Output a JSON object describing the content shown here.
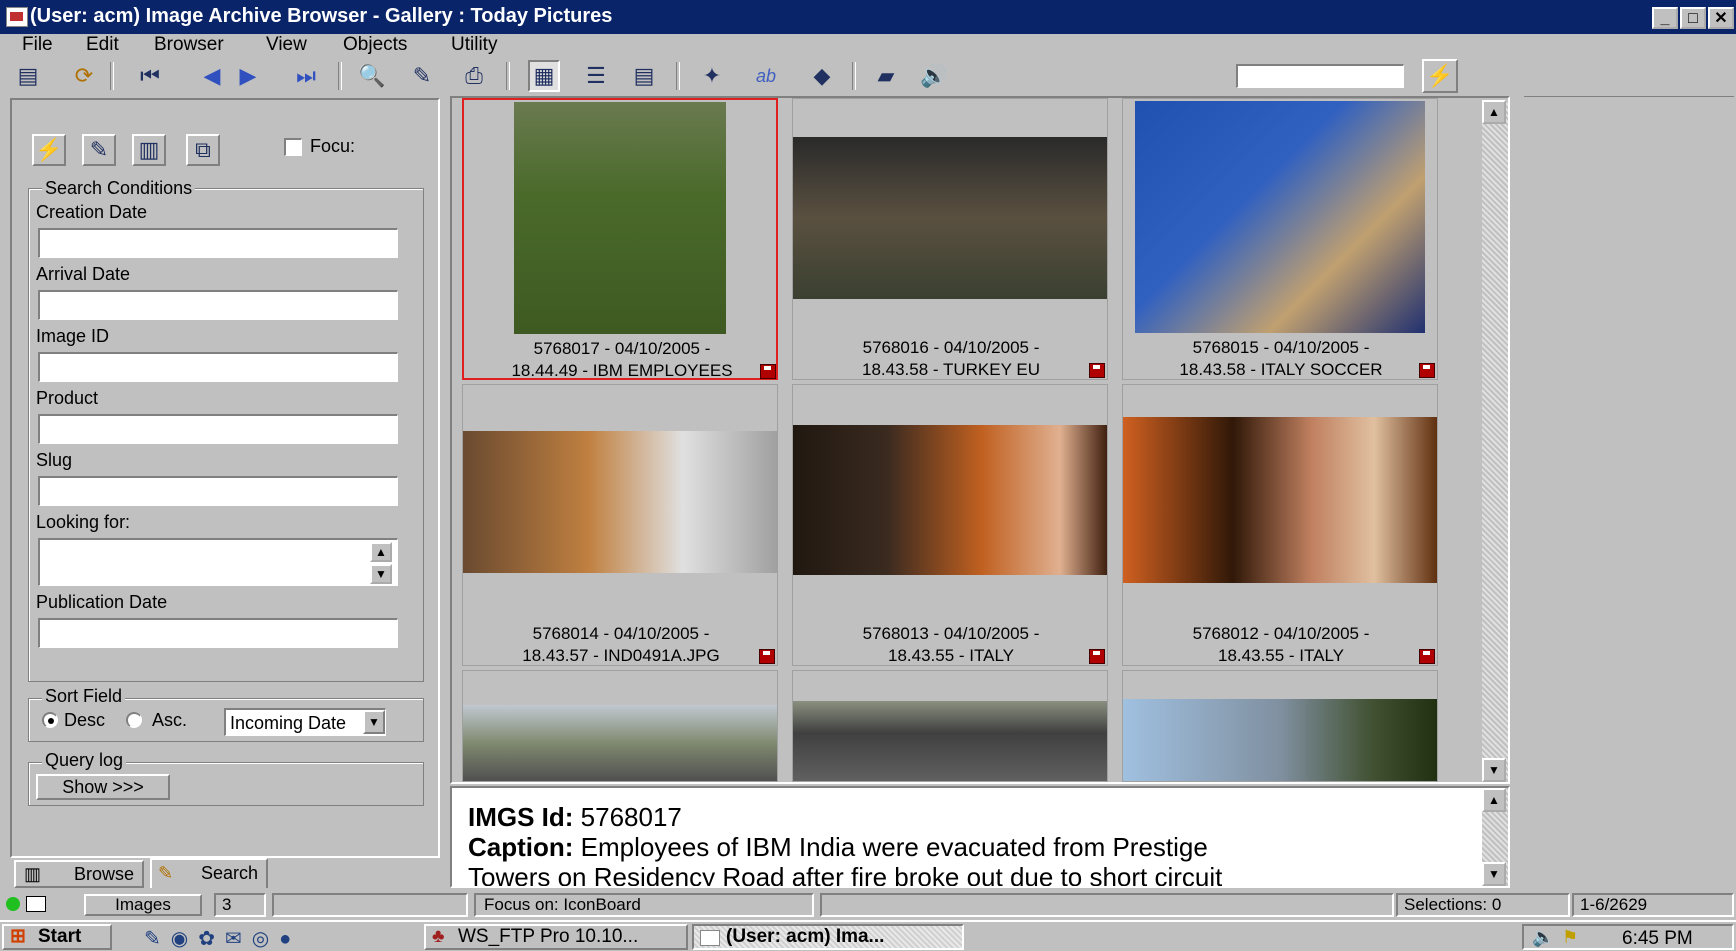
{
  "window": {
    "title": "(User: acm) Image Archive Browser - Gallery : Today Pictures"
  },
  "window_controls": {
    "minimize": "_",
    "maximize": "□",
    "close": "✕"
  },
  "menu": [
    "File",
    "Edit",
    "Browser",
    "View",
    "Objects",
    "Utility"
  ],
  "toolbar": {
    "search_value": ""
  },
  "left_panel": {
    "focus_label": "Focu:",
    "search_conditions_title": "Search Conditions",
    "fields": [
      {
        "label": "Creation Date",
        "value": ""
      },
      {
        "label": "Arrival Date",
        "value": ""
      },
      {
        "label": "Image ID",
        "value": ""
      },
      {
        "label": "Product",
        "value": ""
      },
      {
        "label": "Slug",
        "value": ""
      },
      {
        "label": "Looking for:",
        "value": ""
      },
      {
        "label": "Publication Date",
        "value": ""
      }
    ],
    "sort_field_title": "Sort Field",
    "sort_desc": "Desc",
    "sort_asc": "Asc.",
    "sort_selected": "desc",
    "sort_select_value": "Incoming Date",
    "query_log_title": "Query log",
    "show_button": "Show >>>",
    "tabs": [
      {
        "label": "Browse"
      },
      {
        "label": "Search"
      }
    ]
  },
  "gallery": {
    "items": [
      {
        "line1": "5768017 - 04/10/2005 -",
        "line2": "18.44.49 - IBM EMPLOYEES",
        "selected": true
      },
      {
        "line1": "5768016 - 04/10/2005 -",
        "line2": "18.43.58 - TURKEY EU",
        "selected": false
      },
      {
        "line1": "5768015 - 04/10/2005 -",
        "line2": "18.43.58 - ITALY SOCCER",
        "selected": false
      },
      {
        "line1": "5768014 - 04/10/2005 -",
        "line2": "18.43.57 - IND0491A.JPG",
        "selected": false
      },
      {
        "line1": "5768013 - 04/10/2005 -",
        "line2": "18.43.55 - ITALY",
        "selected": false
      },
      {
        "line1": "5768012 - 04/10/2005 -",
        "line2": "18.43.55 - ITALY",
        "selected": false
      }
    ]
  },
  "details": {
    "id_label": "IMGS Id:",
    "id_value": "5768017",
    "caption_label": "Caption:",
    "caption_line1": "Employees of IBM India were evacuated from Prestige",
    "caption_line2": "Towers on Residency Road after fire broke out due to short circuit"
  },
  "statusbar": {
    "images_label": "Images",
    "images_count": "3",
    "focus": "Focus on: IconBoard",
    "selections": "Selections: 0",
    "range": "1-6/2629"
  },
  "taskbar": {
    "start": "Start",
    "tasks": [
      "WS_FTP Pro 10.10...",
      "(User: acm) Ima..."
    ],
    "clock": "6:45 PM"
  },
  "colors": {
    "titlebar": "#0a246a",
    "selection_border": "#e02020",
    "face": "#c0c0c0"
  }
}
